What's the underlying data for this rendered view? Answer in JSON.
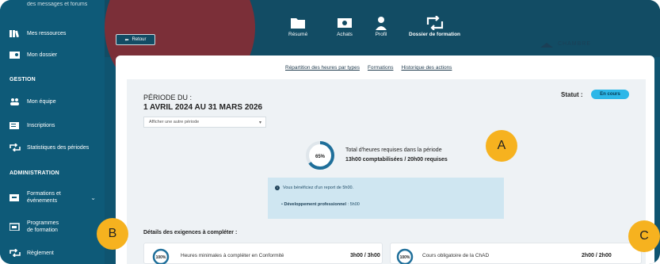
{
  "sidebar": {
    "partial_top_label": "des messages et forums",
    "items_top": [
      {
        "label": "Mes ressources",
        "icon": "books-icon"
      },
      {
        "label": "Mon dossier",
        "icon": "folder-icon"
      }
    ],
    "section_gestion": "GESTION",
    "items_gestion": [
      {
        "label": "Mon équipe",
        "icon": "team-icon"
      },
      {
        "label": "Inscriptions",
        "icon": "registration-icon"
      },
      {
        "label": "Statistiques des périodes",
        "icon": "cycle-icon"
      }
    ],
    "section_admin": "ADMINISTRATION",
    "items_admin": [
      {
        "label": "Formations et événements",
        "icon": "training-icon"
      },
      {
        "label": "Programmes de formation",
        "icon": "program-icon"
      },
      {
        "label": "Règlement",
        "icon": "cycle-icon"
      }
    ]
  },
  "header": {
    "back_label": "Retour",
    "nav": [
      {
        "label": "Résumé",
        "icon": "folder-icon"
      },
      {
        "label": "Achats",
        "icon": "money-icon"
      },
      {
        "label": "Profil",
        "icon": "user-icon"
      },
      {
        "label": "Dossier de formation",
        "icon": "cycle-icon"
      }
    ],
    "brand": "CHAMBRE"
  },
  "tabs": [
    "Répartition des heures par types",
    "Formations",
    "Historique des actions"
  ],
  "period": {
    "label": "PÉRIODE DU :",
    "value": "1 AVRIL 2024 AU 31 MARS 2026",
    "select_placeholder": "Afficher une autre période"
  },
  "status": {
    "label": "Statut :",
    "value": "En cours"
  },
  "total": {
    "percent": 65,
    "percent_label": "65%",
    "title": "Total d'heures requises dans la période",
    "detail": "13h00 comptabilisées / 20h00 requises"
  },
  "info": {
    "report": "Vous bénéficiez d'un report de 5h00.",
    "bullet_label": "Développement professionnel",
    "bullet_value": ": 5h00"
  },
  "details_title": "Détails des exigences à compléter :",
  "requirements": [
    {
      "percent_label": "100%",
      "label": "Heures minimales à compléter en Conformité",
      "value": "3h00 / 3h00"
    },
    {
      "percent_label": "100%",
      "label": "Cours obligatoire de la ChAD",
      "value": "2h00 / 2h00"
    }
  ],
  "callouts": [
    "A",
    "B",
    "C"
  ],
  "colors": {
    "sidebar": "#0e5a78",
    "accent_badge": "#2db7e8",
    "ring": "#1f6f9a",
    "callout": "#f6b21f",
    "info_box": "#cfe6f1"
  }
}
